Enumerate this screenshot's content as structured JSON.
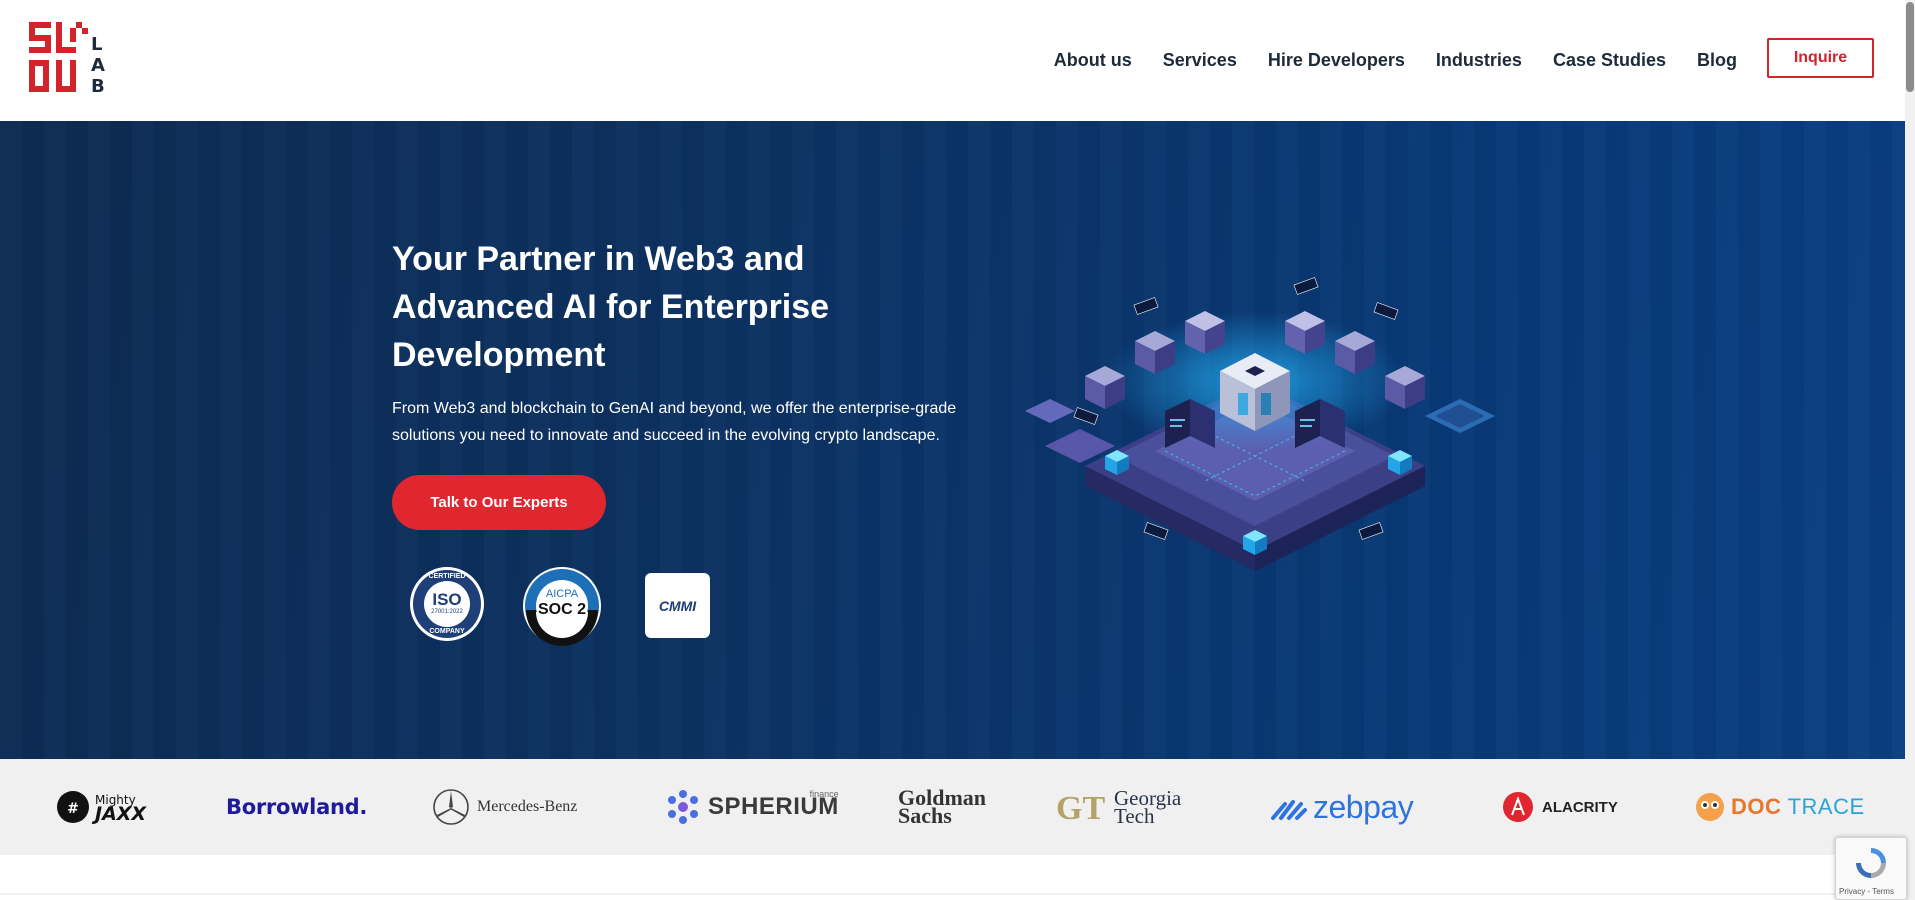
{
  "header": {
    "logo_letters": "LAB",
    "nav": [
      {
        "label": "About us"
      },
      {
        "label": "Services"
      },
      {
        "label": "Hire Developers"
      },
      {
        "label": "Industries"
      },
      {
        "label": "Case Studies"
      },
      {
        "label": "Blog"
      }
    ],
    "inquire_label": "Inquire"
  },
  "hero": {
    "title": "Your Partner in Web3 and Advanced AI for Enterprise Development",
    "description": "From Web3 and blockchain to GenAI and beyond, we offer the enterprise-grade solutions you need to innovate and succeed in the evolving crypto landscape.",
    "cta_label": "Talk to Our Experts",
    "badges": {
      "iso_top": "CERTIFIED",
      "iso_main": "ISO",
      "iso_code": "27001:2022",
      "iso_bottom": "COMPANY",
      "soc_top": "AICPA",
      "soc_main": "SOC 2",
      "cmmi": "CMMI"
    }
  },
  "clients": {
    "mighty_top": "Mighty",
    "mighty_bottom": "JAXX",
    "borrowland": "Borrowland.",
    "mercedes": "Mercedes-Benz",
    "spherium": "SPHERIUM",
    "spherium_sub": "finance",
    "goldman_top": "Goldman",
    "goldman_bottom": "Sachs",
    "georgia_top": "Georgia",
    "georgia_bottom": "Tech",
    "zebpay": "zebpay",
    "alacrity": "ALACRITY",
    "doc": "DOC",
    "trace": "TRACE"
  },
  "recaptcha": {
    "terms": "Privacy - Terms"
  },
  "colors": {
    "brand_red": "#d3242b",
    "hero_blue": "#0c3263",
    "cta_red": "#e0262f"
  }
}
